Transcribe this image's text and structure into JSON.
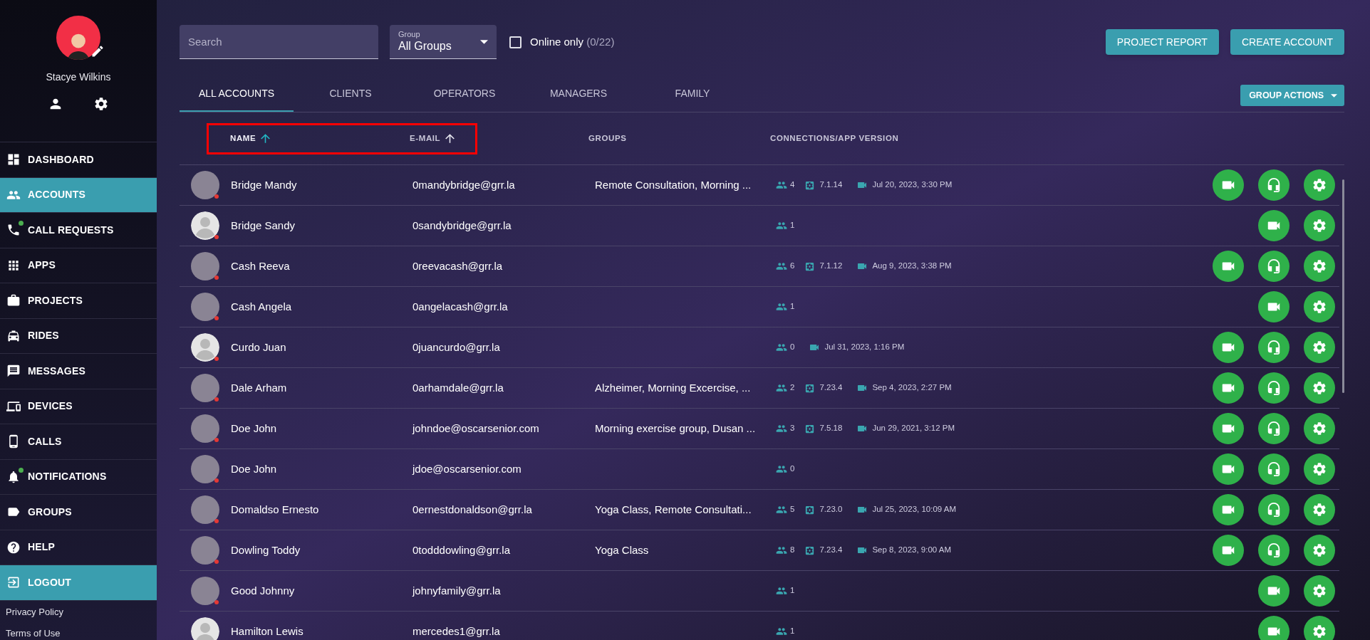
{
  "profile": {
    "name": "Stacye Wilkins"
  },
  "menu": [
    {
      "label": "DASHBOARD",
      "selected": false,
      "dot": false
    },
    {
      "label": "ACCOUNTS",
      "selected": true,
      "dot": false
    },
    {
      "label": "CALL REQUESTS",
      "selected": false,
      "dot": true
    },
    {
      "label": "APPS",
      "selected": false,
      "dot": false
    },
    {
      "label": "PROJECTS",
      "selected": false,
      "dot": false
    },
    {
      "label": "RIDES",
      "selected": false,
      "dot": false
    },
    {
      "label": "MESSAGES",
      "selected": false,
      "dot": false
    },
    {
      "label": "DEVICES",
      "selected": false,
      "dot": false
    },
    {
      "label": "CALLS",
      "selected": false,
      "dot": false
    },
    {
      "label": "NOTIFICATIONS",
      "selected": false,
      "dot": true
    },
    {
      "label": "GROUPS",
      "selected": false,
      "dot": false
    },
    {
      "label": "HELP",
      "selected": false,
      "dot": false
    },
    {
      "label": "LOGOUT",
      "selected": true,
      "dot": false
    }
  ],
  "footer_links": [
    "Privacy Policy",
    "Terms of Use"
  ],
  "search": {
    "placeholder": "Search"
  },
  "group_select": {
    "label": "Group",
    "value": "All Groups"
  },
  "online_only": {
    "label": "Online only",
    "count": "(0/22)",
    "checked": false
  },
  "buttons": [
    "PROJECT REPORT",
    "CREATE ACCOUNT"
  ],
  "tabs": [
    {
      "label": "ALL ACCOUNTS",
      "selected": true
    },
    {
      "label": "CLIENTS",
      "selected": false
    },
    {
      "label": "OPERATORS",
      "selected": false
    },
    {
      "label": "MANAGERS",
      "selected": false
    },
    {
      "label": "FAMILY",
      "selected": false
    }
  ],
  "group_actions": "GROUP ACTIONS",
  "columns": [
    {
      "label": "NAME",
      "sort_arrow": true,
      "active": true
    },
    {
      "label": "E-MAIL",
      "sort_arrow": true,
      "active": false
    },
    {
      "label": "GROUPS",
      "sort_arrow": false,
      "active": false
    },
    {
      "label": "CONNECTIONS/APP VERSION",
      "sort_arrow": false,
      "active": false
    }
  ],
  "rows": [
    {
      "name": "Bridge Mandy",
      "email": "0mandybridge@grr.la",
      "groups": "Remote Consultation, Morning ...",
      "connections": "4",
      "version": "7.1.14",
      "last_call": "Jul 20, 2023, 3:30 PM",
      "default_avatar": false,
      "headset": true
    },
    {
      "name": "Bridge Sandy",
      "email": "0sandybridge@grr.la",
      "connections": "1",
      "default_avatar": true,
      "headset": false
    },
    {
      "name": "Cash Reeva",
      "email": "0reevacash@grr.la",
      "connections": "6",
      "version": "7.1.12",
      "last_call": "Aug 9, 2023, 3:38 PM",
      "default_avatar": false,
      "headset": true
    },
    {
      "name": "Cash Angela",
      "email": "0angelacash@grr.la",
      "connections": "1",
      "default_avatar": false,
      "headset": false
    },
    {
      "name": "Curdo Juan",
      "email": "0juancurdo@grr.la",
      "connections": "0",
      "last_call": "Jul 31, 2023, 1:16 PM",
      "default_avatar": true,
      "headset": true
    },
    {
      "name": "Dale Arham",
      "email": "0arhamdale@grr.la",
      "groups": "Alzheimer, Morning Excercise, ...",
      "connections": "2",
      "version": "7.23.4",
      "last_call": "Sep 4, 2023, 2:27 PM",
      "default_avatar": false,
      "headset": true
    },
    {
      "name": "Doe John",
      "email": "johndoe@oscarsenior.com",
      "groups": "Morning exercise group, Dusan ...",
      "connections": "3",
      "version": "7.5.18",
      "last_call": "Jun 29, 2021, 3:12 PM",
      "default_avatar": false,
      "headset": true
    },
    {
      "name": "Doe John",
      "email": "jdoe@oscarsenior.com",
      "connections": "0",
      "default_avatar": false,
      "headset": true
    },
    {
      "name": "Domaldso Ernesto",
      "email": "0ernestdonaldson@grr.la",
      "groups": "Yoga Class, Remote Consultati...",
      "connections": "5",
      "version": "7.23.0",
      "last_call": "Jul 25, 2023, 10:09 AM",
      "default_avatar": false,
      "headset": true
    },
    {
      "name": "Dowling Toddy",
      "email": "0todddowling@grr.la",
      "groups": "Yoga Class",
      "connections": "8",
      "version": "7.23.4",
      "last_call": "Sep 8, 2023, 9:00 AM",
      "default_avatar": false,
      "headset": true
    },
    {
      "name": "Good Johnny",
      "email": "johnyfamily@grr.la",
      "connections": "1",
      "default_avatar": false,
      "headset": false
    },
    {
      "name": "Hamilton Lewis",
      "email": "mercedes1@grr.la",
      "connections": "1",
      "default_avatar": true,
      "headset": false
    }
  ]
}
